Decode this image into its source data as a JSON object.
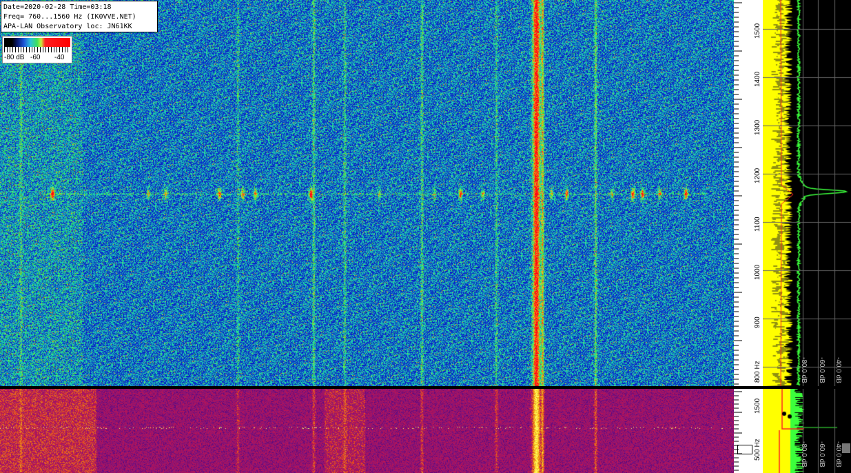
{
  "info": {
    "line1": "Date=2020-02-28 Time=03:18",
    "line2": "Freq= 760...1560 Hz (IK0VVE.NET)",
    "line3": "APA-LAN Observatory loc: JN61KK"
  },
  "legend": {
    "labels": [
      "-80 dB",
      "-60",
      "-40"
    ]
  },
  "freq_axis_top": {
    "labels": [
      "1500",
      "1400",
      "1300",
      "1200",
      "1100",
      "1000",
      "900",
      "800 Hz"
    ]
  },
  "freq_axis_bottom": {
    "labels": [
      "1500",
      "500 Hz"
    ]
  },
  "db_axis_top": {
    "labels": [
      "-80.0 dB",
      "-60.0 dB",
      "-40.0 dB"
    ]
  },
  "db_axis_bottom": {
    "labels": [
      "-80.0 dB",
      "-60.0 dB",
      "-40.0 dB"
    ]
  },
  "colors": {
    "spectrum_yellow": "#ffff00",
    "spectrum_green": "#3cff3c",
    "signal_red": "#ff2020",
    "grid": "#666666"
  }
}
